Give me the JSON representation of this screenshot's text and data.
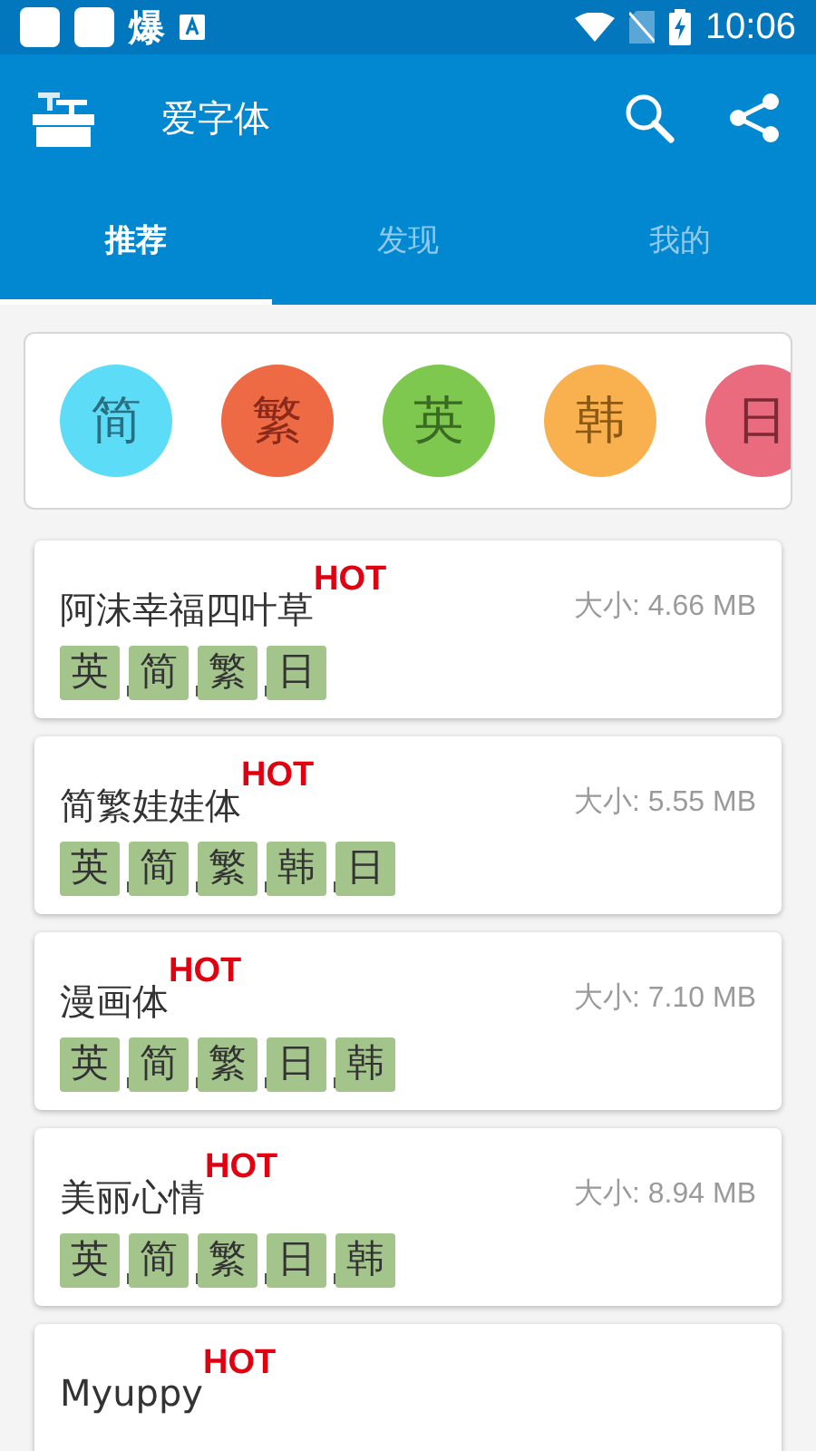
{
  "status_bar": {
    "notification_text": "爆",
    "time": "10:06"
  },
  "app_bar": {
    "title": "爱字体"
  },
  "tabs": [
    {
      "label": "推荐",
      "selected": true
    },
    {
      "label": "发现",
      "selected": false
    },
    {
      "label": "我的",
      "selected": false
    }
  ],
  "categories": [
    {
      "label": "简",
      "color": "#5ddcf7"
    },
    {
      "label": "繁",
      "color": "#ee6a45"
    },
    {
      "label": "英",
      "color": "#7ec850"
    },
    {
      "label": "韩",
      "color": "#f9b150"
    },
    {
      "label": "日",
      "color": "#ea6a7e"
    }
  ],
  "fonts": [
    {
      "name": "阿沫幸福四叶草",
      "badge": "HOT",
      "size": "大小: 4.66 MB",
      "tags": [
        "英",
        "简",
        "繁",
        "日"
      ]
    },
    {
      "name": "简繁娃娃体",
      "badge": "HOT",
      "size": "大小: 5.55 MB",
      "tags": [
        "英",
        "简",
        "繁",
        "韩",
        "日"
      ]
    },
    {
      "name": "漫画体",
      "badge": "HOT",
      "size": "大小: 7.10 MB",
      "tags": [
        "英",
        "简",
        "繁",
        "日",
        "韩"
      ]
    },
    {
      "name": "美丽心情",
      "badge": "HOT",
      "size": "大小: 8.94 MB",
      "tags": [
        "英",
        "简",
        "繁",
        "日",
        "韩"
      ]
    },
    {
      "name": "Myuppy",
      "badge": "HOT"
    }
  ]
}
